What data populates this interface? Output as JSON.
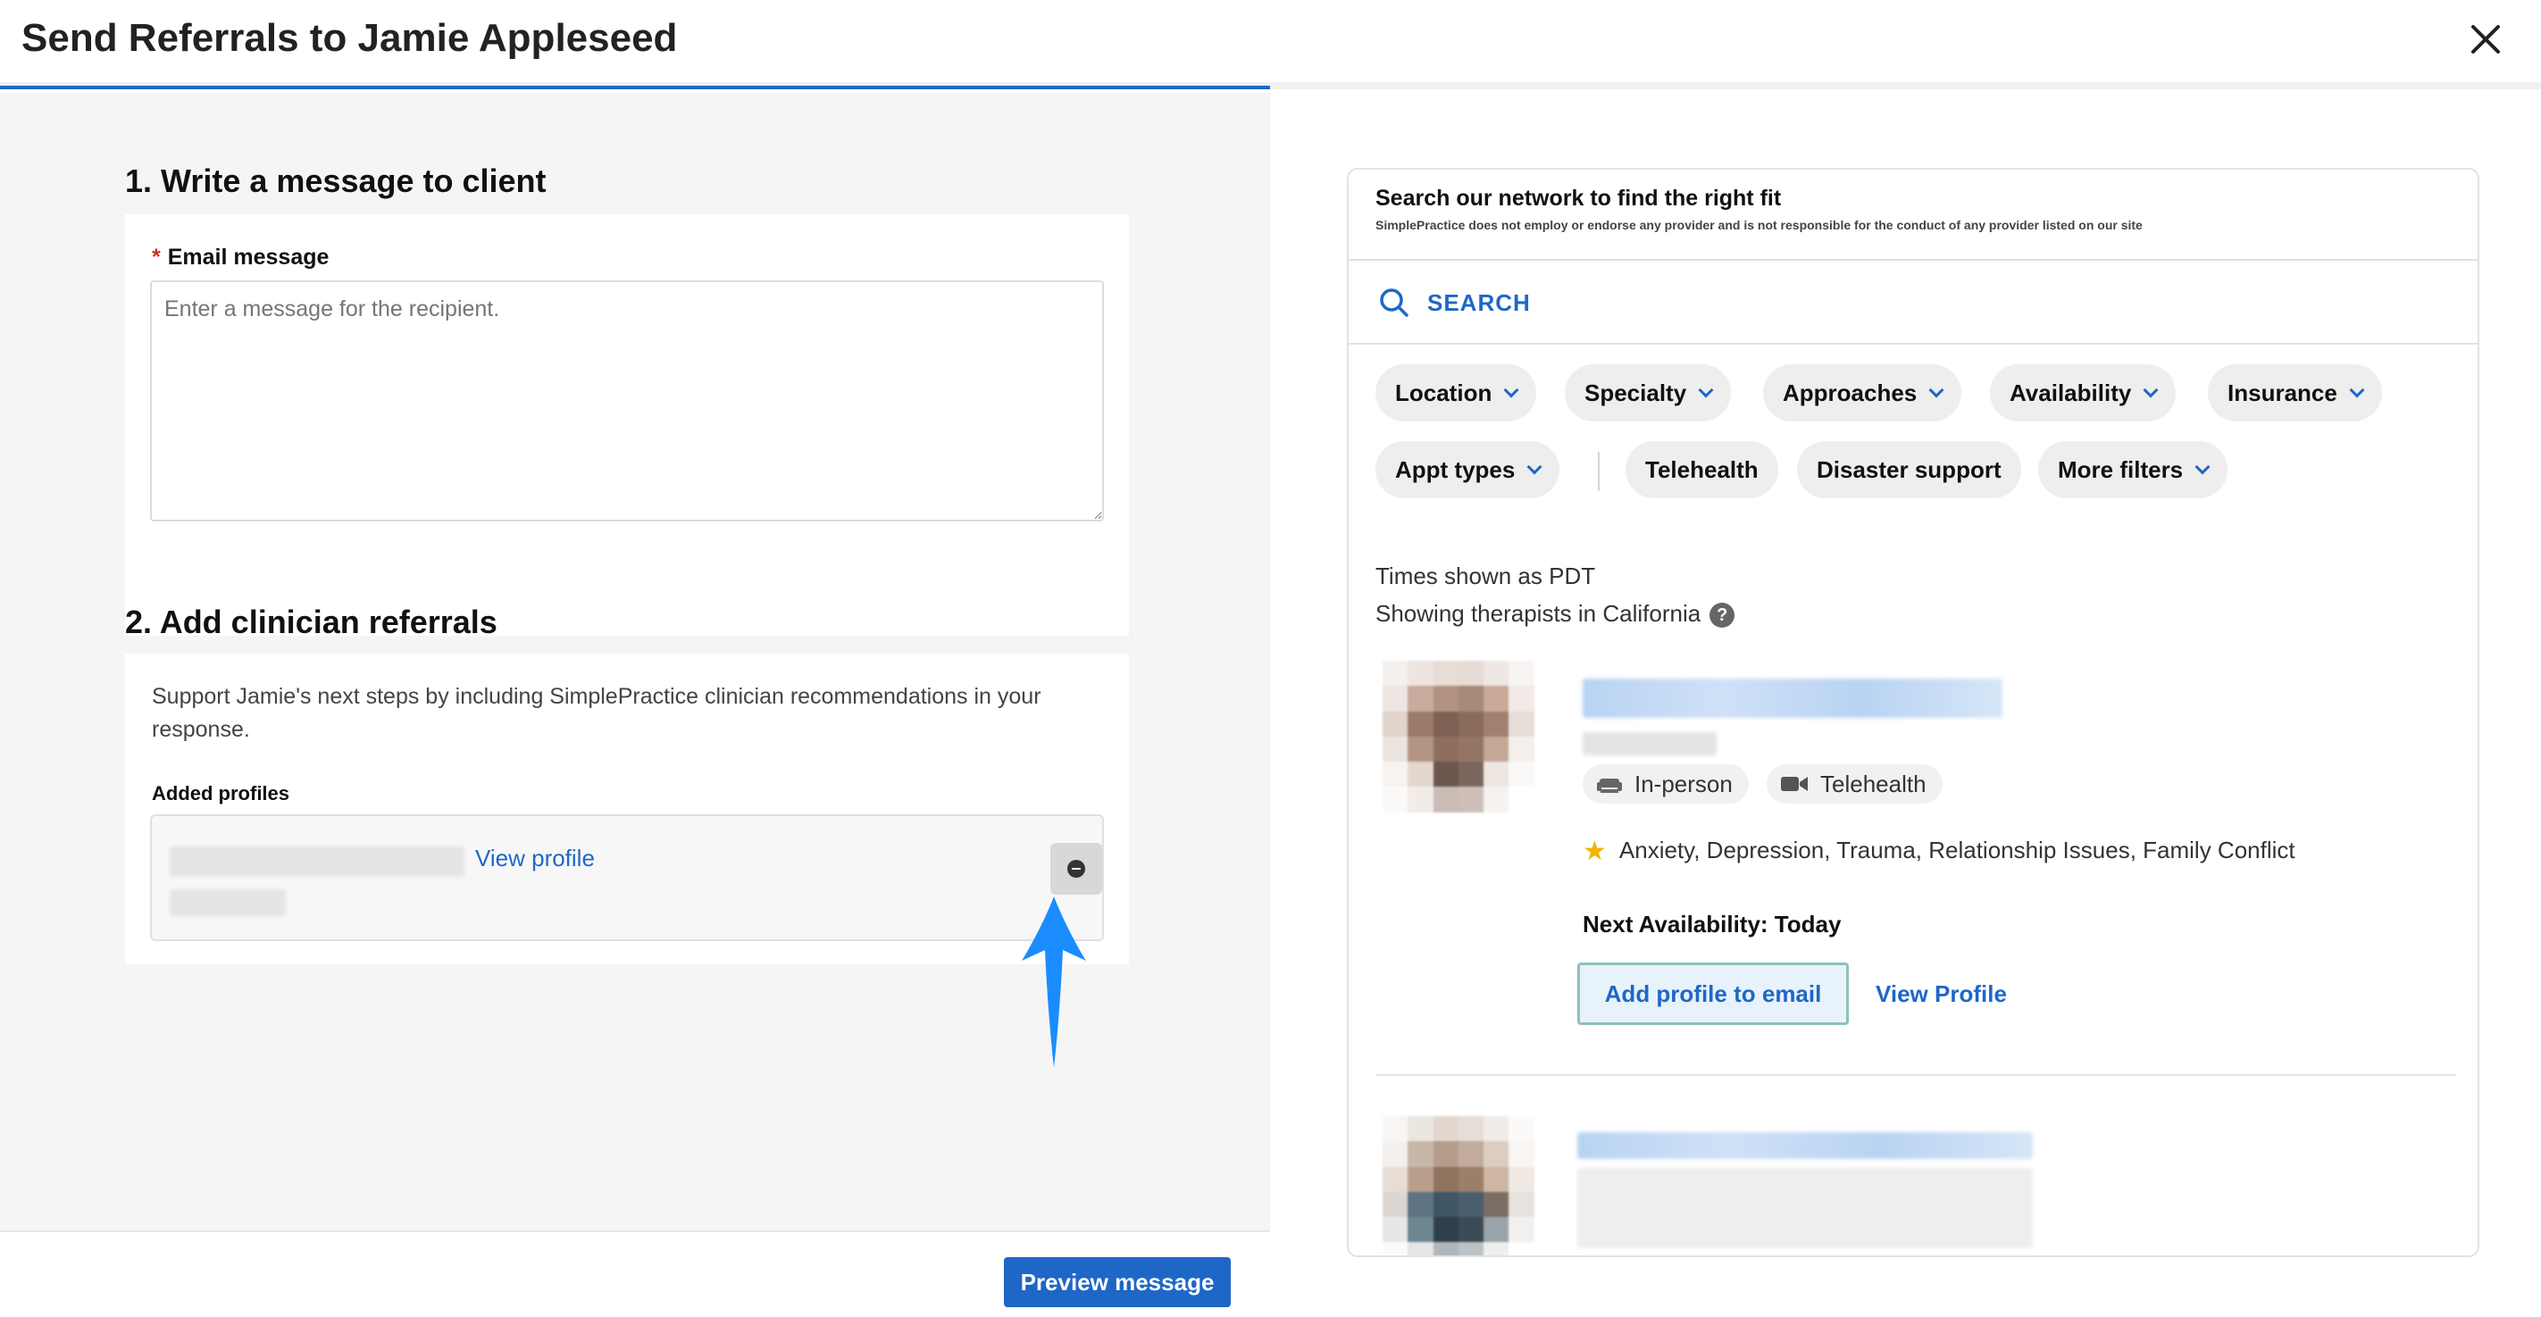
{
  "header": {
    "title": "Send Referrals to Jamie Appleseed"
  },
  "compose": {
    "section1_title": "1. Write a message to client",
    "email_label": "Email message",
    "required_marker": "*",
    "email_placeholder": "Enter a message for the recipient.",
    "email_value": "",
    "section2_title": "2. Add clinician referrals",
    "help_text": "Support Jamie's next steps by including SimplePractice clinician recommendations in your response.",
    "added_profiles_label": "Added profiles",
    "view_profile_link": "View profile",
    "preview_button": "Preview message"
  },
  "network": {
    "title": "Search our network to find the right fit",
    "disclaimer": "SimplePractice does not employ or endorse any provider and is not responsible for the conduct of any provider listed on our site",
    "search_label": "SEARCH",
    "filters_row1": [
      "Location",
      "Specialty",
      "Approaches",
      "Availability",
      "Insurance"
    ],
    "filters_row2": {
      "appt_types": "Appt types",
      "telehealth": "Telehealth",
      "disaster": "Disaster support",
      "more": "More filters"
    },
    "times_shown": "Times shown as PDT",
    "showing": "Showing therapists in California",
    "help_icon": "?",
    "result": {
      "mode_inperson": "In-person",
      "mode_telehealth": "Telehealth",
      "specialties": "Anxiety, Depression, Trauma, Relationship Issues, Family Conflict",
      "next_availability": "Next Availability: Today",
      "add_button": "Add profile to email",
      "view_profile": "View Profile"
    }
  },
  "colors": {
    "primary": "#1f67c6",
    "annotation_arrow": "#1a8cff",
    "star": "#f2b400"
  }
}
